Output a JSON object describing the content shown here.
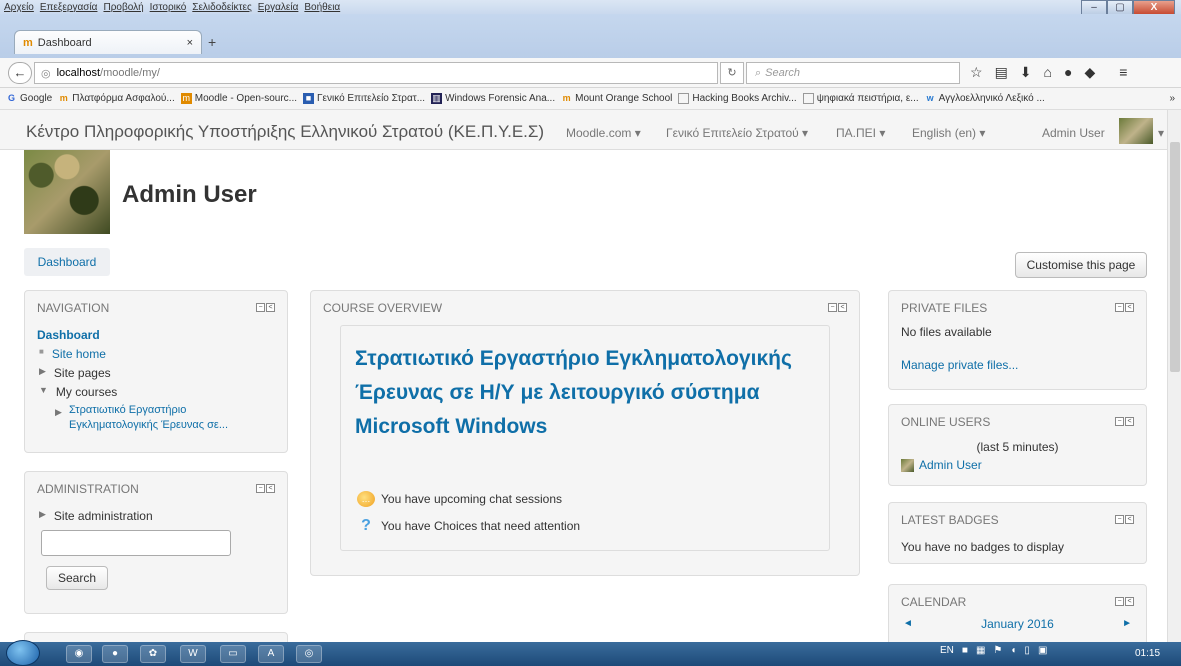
{
  "menubar": {
    "items": [
      "Αρχείο",
      "Επεξεργασία",
      "Προβολή",
      "Ιστορικό",
      "Σελιδοδείκτες",
      "Εργαλεία",
      "Βοήθεια"
    ]
  },
  "window": {
    "minimize": "–",
    "maximize": "▢",
    "close": "X"
  },
  "tab": {
    "label": "Dashboard",
    "close": "×",
    "new": "+"
  },
  "url": {
    "host": "localhost",
    "path": "/moodle/my/",
    "search_placeholder": "Search"
  },
  "bookmarks": [
    "Google",
    "Πλατφόρμα Ασφαλού...",
    "Moodle - Open-sourc...",
    "Γενικό Επιτελείο Στρατ...",
    "Windows Forensic Ana...",
    "Mount Orange School",
    "Hacking Books Archiv...",
    "ψηφιακά πειστήρια, ε...",
    "Αγγλοελληνικό Λεξικό ..."
  ],
  "moodle_nav": {
    "site_name": "Κέντρο Πληροφορικής Υποστήριξης Ελληνικού Στρατού (ΚΕ.Π.Υ.Ε.Σ)",
    "items": [
      "Moodle.com ▾",
      "Γενικό Επιτελείο Στρατού ▾",
      "ΠΑ.ΠΕΙ ▾",
      "English (en) ▾"
    ],
    "user": "Admin User"
  },
  "header": {
    "username": "Admin User",
    "dashboard_button": "Dashboard",
    "customise_button": "Customise this page"
  },
  "navigation": {
    "title": "NAVIGATION",
    "dashboard": "Dashboard",
    "site_home": "Site home",
    "site_pages": "Site pages",
    "my_courses": "My courses",
    "course_line1": "Στρατιωτικό Εργαστήριο",
    "course_line2": "Εγκληματολογικής Έρευνας σε..."
  },
  "administration": {
    "title": "ADMINISTRATION",
    "site_admin": "Site administration",
    "search_button": "Search"
  },
  "course_overview": {
    "title": "COURSE OVERVIEW",
    "course_title": "Στρατιωτικό Εργαστήριο Εγκληματολογικής Έρευνας σε Η/Υ με λειτουργικό σύστημα Microsoft Windows",
    "notice_chat": "You have upcoming chat sessions",
    "notice_choices": "You have Choices that need attention"
  },
  "private_files": {
    "title": "PRIVATE FILES",
    "empty": "No files available",
    "manage": "Manage private files..."
  },
  "online_users": {
    "title": "ONLINE USERS",
    "period": "(last 5 minutes)",
    "user": "Admin User"
  },
  "latest_badges": {
    "title": "LATEST BADGES",
    "empty": "You have no badges to display"
  },
  "calendar": {
    "title": "CALENDAR",
    "month": "January 2016",
    "prev": "◄",
    "next": "►"
  },
  "taskbar": {
    "lang": "EN",
    "clock": "01:15"
  }
}
